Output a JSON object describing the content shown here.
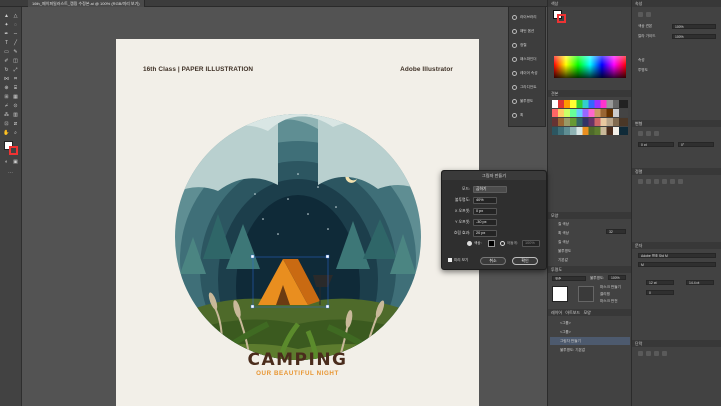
{
  "document_tab": {
    "title": "16th_페이퍼일러스트_캠핑 수정본.ai @ 100% (RGB/미리 보기)"
  },
  "artwork": {
    "heading_left": "16th Class  |  PAPER ILLUSTRATION",
    "heading_right": "Adobe Illustrator",
    "title": "CAMPING",
    "subtitle": "OUR BEAUTIFUL NIGHT"
  },
  "floating_panel": {
    "items": [
      {
        "label": "라이브러리",
        "icon": "library-icon"
      },
      {
        "label": "패턴 옵션",
        "icon": "pattern-icon"
      },
      {
        "label": "정렬",
        "icon": "align-icon"
      },
      {
        "label": "패스파인더",
        "icon": "pathfinder-icon"
      },
      {
        "label": "레이어 속성",
        "icon": "layer-icon"
      },
      {
        "label": "그라디언트",
        "icon": "gradient-icon"
      },
      {
        "label": "불투명도",
        "icon": "opacity-icon"
      },
      {
        "label": "획",
        "icon": "stroke-icon"
      }
    ]
  },
  "swatch_panel": {
    "color_tab": "색상",
    "swatches_tab": "견본",
    "appearance": {
      "header": "모양",
      "rows": [
        {
          "label": "칠 색상"
        },
        {
          "label": "획 색상",
          "value": "32"
        },
        {
          "label": "칠 색상"
        },
        {
          "label": "불투명도"
        },
        {
          "label": "기본값"
        }
      ]
    },
    "transparency": {
      "header": "투명도",
      "mode": "표준",
      "opacity_label": "불투명도:",
      "opacity_value": "100%",
      "make_mask": "마스크 만들기",
      "clip": "클리핑",
      "invert": "마스크 반전"
    },
    "layers": {
      "tabs": [
        "레이어",
        "아트보드",
        "모양"
      ],
      "rows": [
        "<그룹>",
        "<그룹>",
        "그림자 만들기",
        "불투명도: 기본값"
      ]
    }
  },
  "right_panel": {
    "sections": [
      "속성",
      "변형",
      "문자",
      "단락",
      "정렬"
    ],
    "font": "Adobe 명조 Std M",
    "font_style": "M",
    "size": "12 pt",
    "leading": "14.4 pt",
    "tracking": "0",
    "values": [
      "100%",
      "100%",
      "0 pt",
      "0°"
    ],
    "labels": [
      "색상 견본",
      "칼라 가이드",
      "속성",
      "투명도"
    ]
  },
  "dialog": {
    "title": "그림자 만들기",
    "mode_label": "모드:",
    "mode_value": "곱하기",
    "opacity_label": "불투명도:",
    "opacity_value": "40%",
    "x_label": "X 오프셋:",
    "x_value": "0 px",
    "y_label": "Y 오프셋:",
    "y_value": "-30 px",
    "blur_label": "흐림 효과:",
    "blur_value": "20 px",
    "color_label": "색상:",
    "darkness_label": "어둡게:",
    "darkness_value": "100%",
    "preview_label": "미리 보기",
    "cancel_label": "취소",
    "ok_label": "확인"
  },
  "colors": {
    "accent": "#e89530",
    "title": "#4a2c1c",
    "artboard": "#f2efe8",
    "ui_dark": "#424242"
  }
}
